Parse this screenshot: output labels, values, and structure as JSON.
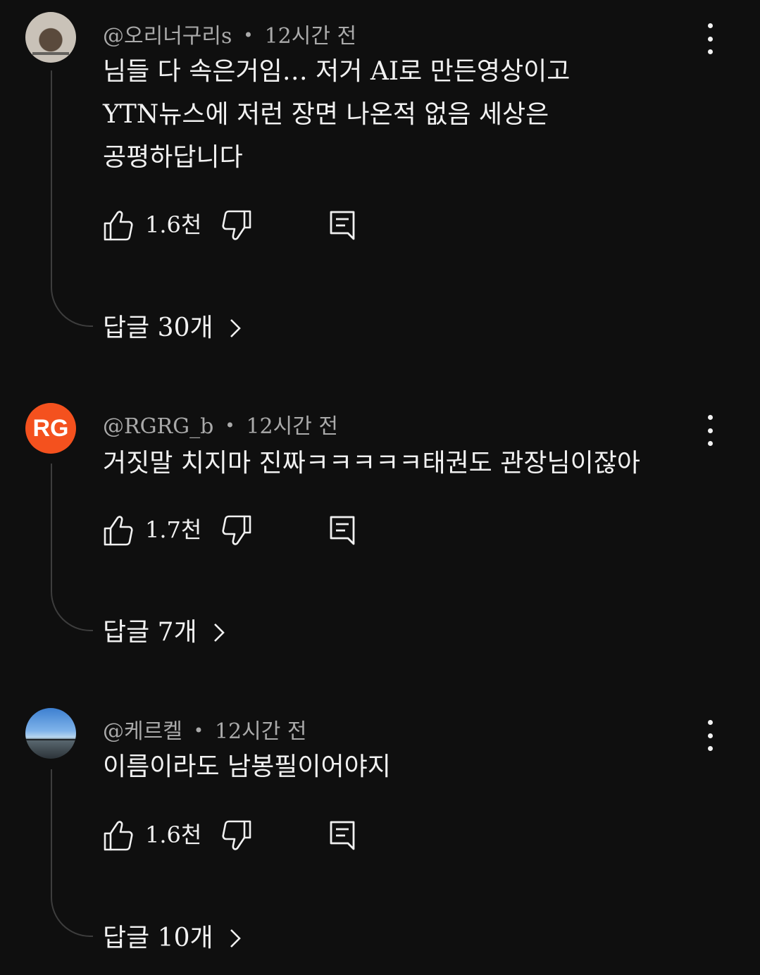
{
  "comments": [
    {
      "avatar": "photo-avatar",
      "author": "@오리너구리s",
      "time": "12시간 전",
      "text_lines": [
        "님들 다 속은거임… 저거 AI로 만든영상이고",
        "YTN뉴스에 저런 장면 나온적 없음 세상은",
        "공평하답니다"
      ],
      "likes": "1.6천",
      "replies_label": "답글 30개"
    },
    {
      "avatar": "initials-avatar",
      "avatar_initials": "RG",
      "avatar_color": "#f4511e",
      "author": "@RGRG_b",
      "time": "12시간 전",
      "text_lines": [
        "거짓말 치지마 진짜ㅋㅋㅋㅋㅋ태권도 관장님이잖아"
      ],
      "likes": "1.7천",
      "replies_label": "답글 7개"
    },
    {
      "avatar": "photo-avatar",
      "author": "@케르켈",
      "time": "12시간 전",
      "text_lines": [
        "이름이라도 남봉필이어야지"
      ],
      "likes": "1.6천",
      "replies_label": "답글 10개"
    }
  ],
  "icons": {
    "like": "thumbs-up-icon",
    "dislike": "thumbs-down-icon",
    "reply": "comment-icon",
    "more": "more-vert-icon",
    "expand": "chevron-right-icon"
  },
  "colors": {
    "background": "#0f0f0f",
    "text": "#f1f1f1",
    "meta": "#aaaaaa"
  }
}
